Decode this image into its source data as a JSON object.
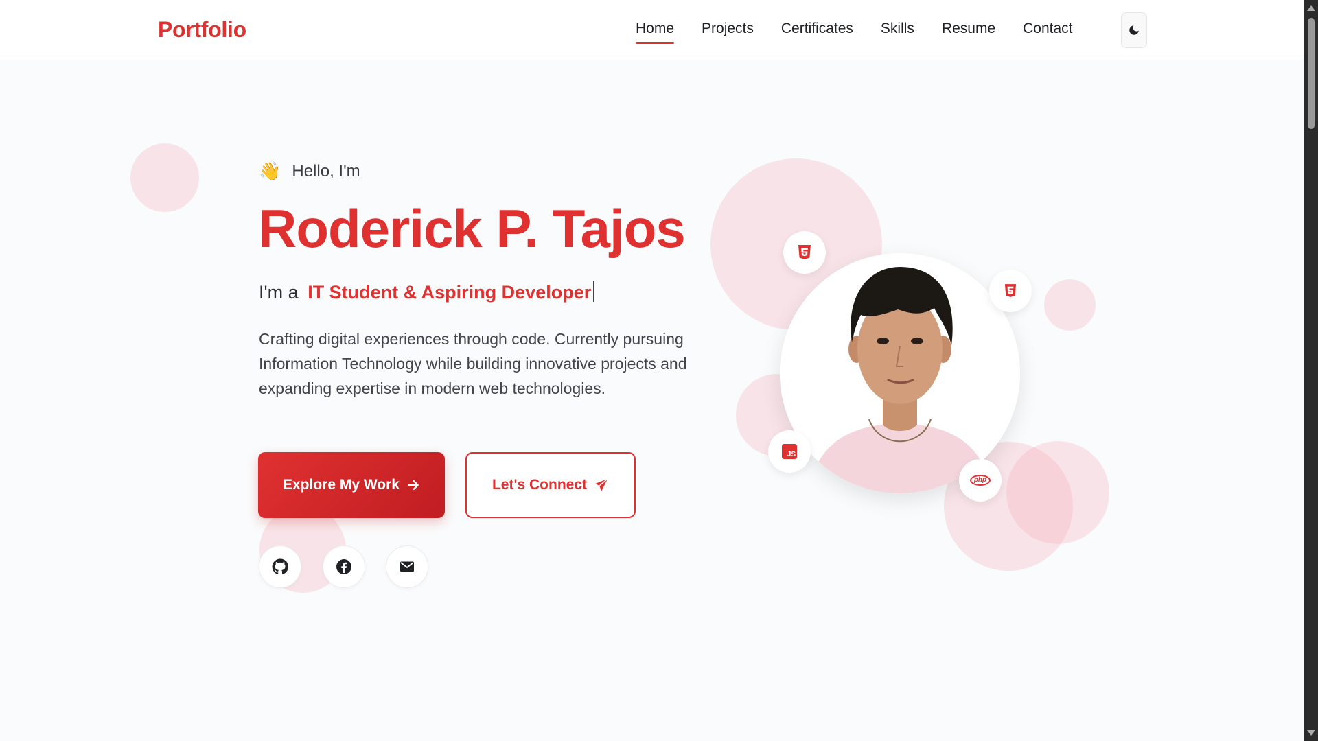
{
  "header": {
    "logo": "Portfolio",
    "nav": [
      {
        "label": "Home",
        "active": true
      },
      {
        "label": "Projects",
        "active": false
      },
      {
        "label": "Certificates",
        "active": false
      },
      {
        "label": "Skills",
        "active": false
      },
      {
        "label": "Resume",
        "active": false
      },
      {
        "label": "Contact",
        "active": false
      }
    ],
    "theme_toggle_icon": "moon-icon"
  },
  "hero": {
    "greeting": "Hello, I'm",
    "wave": "👋",
    "name": "Roderick P. Tajos",
    "role_prefix": "I'm a",
    "role_text": "IT Student & Aspiring Developer",
    "description": "Crafting digital experiences through code. Currently pursuing Information Technology while building innovative projects and expanding expertise in modern web technologies.",
    "primary_button": "Explore My Work",
    "secondary_button": "Let's Connect"
  },
  "social": [
    {
      "name": "github-icon"
    },
    {
      "name": "facebook-icon"
    },
    {
      "name": "mail-icon"
    }
  ],
  "tech_badges": [
    {
      "icon": "html5-icon"
    },
    {
      "icon": "html5-icon"
    },
    {
      "icon": "javascript-icon",
      "text": "JS"
    },
    {
      "icon": "php-icon",
      "text": "php"
    }
  ],
  "colors": {
    "accent": "#e03131",
    "accent_dark": "#c01d22",
    "text": "#1f2125",
    "blob": "#f4aab2"
  }
}
